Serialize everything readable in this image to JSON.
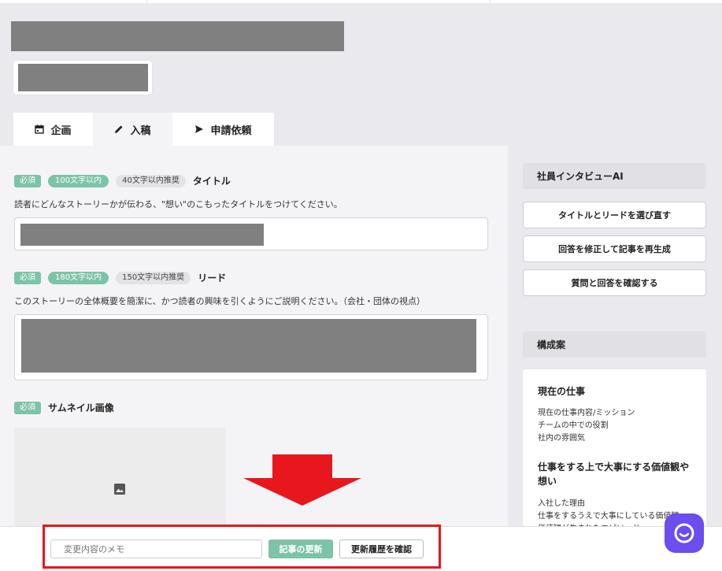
{
  "header": {
    "tabs": [
      {
        "label": "企画",
        "icon": "calendar-icon"
      },
      {
        "label": "入稿",
        "icon": "pencil-icon"
      },
      {
        "label": "申請依頼",
        "icon": "send-icon"
      }
    ]
  },
  "form": {
    "title": {
      "required": "必須",
      "limit": "100文字以内",
      "recommend": "40文字以内推奨",
      "label": "タイトル",
      "help": "読者にどんなストーリーかが伝わる、\"想い\"のこもったタイトルをつけてください。"
    },
    "lead": {
      "required": "必須",
      "limit": "180文字以内",
      "recommend": "150文字以内推奨",
      "label": "リード",
      "help": "このストーリーの全体概要を簡潔に、かつ読者の興味を引くようにご説明ください。（会社・団体の視点）"
    },
    "thumbnail": {
      "required": "必須",
      "label": "サムネイル画像",
      "icon": "image-icon"
    }
  },
  "sidebar": {
    "ai_title": "社員インタビューAI",
    "buttons": [
      "タイトルとリードを選び直す",
      "回答を修正して記事を再生成",
      "質問と回答を確認する"
    ],
    "outline_title": "構成案",
    "outline": [
      {
        "heading": "現在の仕事",
        "items": [
          "現在の仕事内容/ミッション",
          "チームの中での役割",
          "社内の雰囲気"
        ]
      },
      {
        "heading": "仕事をする上で大事にする価値観や想い",
        "items": [
          "入社した理由",
          "仕事をするうえで大事にしている価値観",
          "価値観が生まれたエピソード"
        ]
      }
    ]
  },
  "footer": {
    "memo_placeholder": "変更内容のメモ",
    "update_label": "記事の更新",
    "history_label": "更新履歴を確認"
  },
  "colors": {
    "accent": "#7cc3a8",
    "highlight": "#e8161d",
    "chat": "#6d4cf0"
  }
}
